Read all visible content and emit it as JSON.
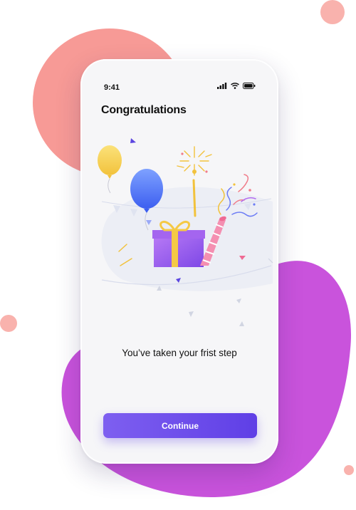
{
  "status_bar": {
    "time": "9:41"
  },
  "header": {
    "title": "Congratulations"
  },
  "body": {
    "message": "You’ve taken your frist step"
  },
  "actions": {
    "continue_label": "Continue"
  },
  "colors": {
    "coral_blob": "#f79a96",
    "purple_blob": "#c953dc",
    "button_start": "#7e5ff0",
    "button_end": "#5f3fe6"
  },
  "icons": [
    "signal-icon",
    "wifi-icon",
    "battery-icon",
    "balloon-icon",
    "gift-icon",
    "party-popper-icon",
    "sparkler-icon",
    "confetti-icon"
  ]
}
